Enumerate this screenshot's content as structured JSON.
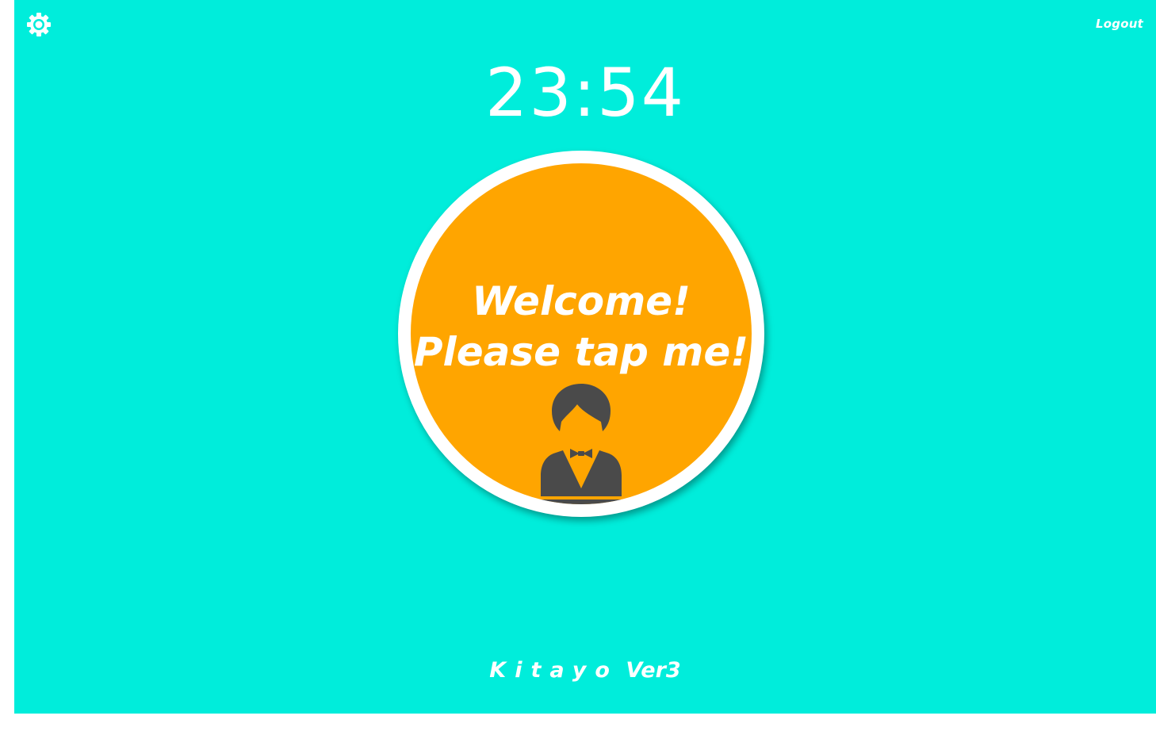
{
  "header": {
    "settings_icon": "gear-icon",
    "logout_label": "Logout"
  },
  "clock": {
    "time": "23:54"
  },
  "tap_button": {
    "line1": "Welcome!",
    "line2": "Please tap me!",
    "icon": "waiter-icon"
  },
  "footer": {
    "brand": "Kitayo",
    "version": "Ver3"
  },
  "colors": {
    "background": "#00eddb",
    "button": "#ffa500",
    "ring": "#ffffff",
    "icon": "#4a4a4a",
    "text": "#ffffff"
  }
}
